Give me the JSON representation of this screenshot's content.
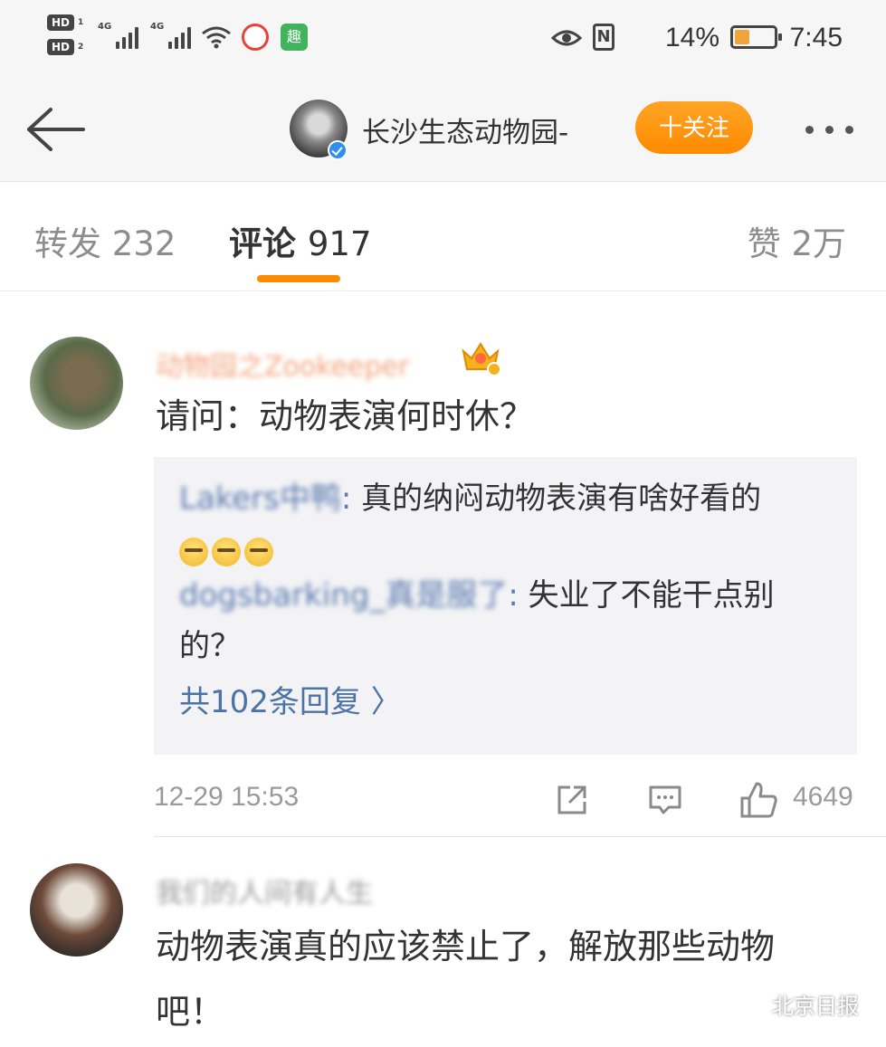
{
  "status_bar": {
    "hd1": "HD",
    "hd1_num": "1",
    "hd2": "HD",
    "hd2_num": "2",
    "signal1": "4G",
    "signal2": "4G",
    "app_icon_green": "趣",
    "battery_pct": "14%",
    "time": "7:45",
    "nfc": "N"
  },
  "header": {
    "account_name": "长沙生态动物园-",
    "follow_label": "十关注"
  },
  "tabs": {
    "repost_label": "转发",
    "repost_count": "232",
    "comments_label": "评论",
    "comments_count": "917",
    "likes_label": "赞",
    "likes_count": "2万"
  },
  "comments": [
    {
      "username": "动物园之Zookeeper",
      "text": "请问：动物表演何时休？",
      "replies": [
        {
          "user": "Lakers中鸭",
          "colon": ":",
          "text": " 真的纳闷动物表演有啥好看的"
        },
        {
          "user": "dogsbarking_真是服了",
          "colon": ":",
          "text": " 失业了不能干点别的？"
        }
      ],
      "more_replies": "共102条回复 〉",
      "time": "12-29 15:53",
      "like_count": "4649"
    },
    {
      "username": "我们的人间有人生",
      "text": "动物表演真的应该禁止了，解放那些动物吧！"
    }
  ],
  "watermark": "北京日报",
  "colors": {
    "accent": "#ff8a00",
    "link": "#4c73a8",
    "reply_bg": "#f3f3f5"
  }
}
